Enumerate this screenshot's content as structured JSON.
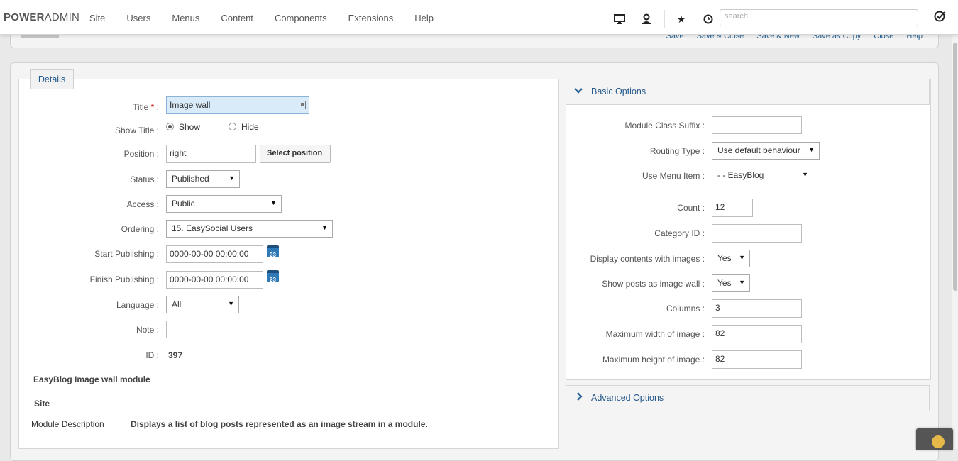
{
  "brand": {
    "part1": "POWER",
    "part2": "ADMIN"
  },
  "menu": [
    "Site",
    "Users",
    "Menus",
    "Content",
    "Components",
    "Extensions",
    "Help"
  ],
  "nav_icons": [
    "monitor-icon",
    "user-icon",
    "star-icon",
    "clock-icon"
  ],
  "search": {
    "placeholder": "search..."
  },
  "toolbar": {
    "actions": [
      "Save",
      "Save & Close",
      "Save & New",
      "Save as Copy",
      "Close",
      "Help"
    ]
  },
  "details": {
    "tab": "Details",
    "title_label": "Title",
    "title_required": "*",
    "title_value": "Image wall",
    "show_title_label": "Show Title",
    "show_title_options": [
      "Show",
      "Hide"
    ],
    "show_title_selected": "Show",
    "position_label": "Position",
    "position_value": "right",
    "select_position": "Select position",
    "status_label": "Status",
    "status_value": "Published",
    "access_label": "Access",
    "access_value": "Public",
    "ordering_label": "Ordering",
    "ordering_value": "15. EasySocial Users",
    "start_label": "Start Publishing",
    "start_value": "0000-00-00 00:00:00",
    "finish_label": "Finish Publishing",
    "finish_value": "0000-00-00 00:00:00",
    "calendar_text": "23",
    "language_label": "Language",
    "language_value": "All",
    "note_label": "Note",
    "note_value": "",
    "id_label": "ID",
    "id_value": "397",
    "module_name": "EasyBlog Image wall module",
    "site": "Site",
    "desc_label": "Module Description",
    "desc_value": "Displays a list of blog posts represented as an image stream in a module."
  },
  "basic": {
    "title": "Basic Options",
    "fields": {
      "class_suffix_label": "Module Class Suffix",
      "class_suffix_value": "",
      "routing_label": "Routing Type",
      "routing_value": "Use default behaviour",
      "menu_item_label": "Use Menu Item",
      "menu_item_value": "- - EasyBlog",
      "count_label": "Count",
      "count_value": "12",
      "category_label": "Category ID",
      "category_value": "",
      "display_images_label": "Display contents with images",
      "display_images_value": "Yes",
      "image_wall_label": "Show posts as image wall",
      "image_wall_value": "Yes",
      "columns_label": "Columns",
      "columns_value": "3",
      "max_width_label": "Maximum width of image",
      "max_width_value": "82",
      "max_height_label": "Maximum height of image",
      "max_height_value": "82"
    }
  },
  "advanced": {
    "title": "Advanced Options"
  }
}
